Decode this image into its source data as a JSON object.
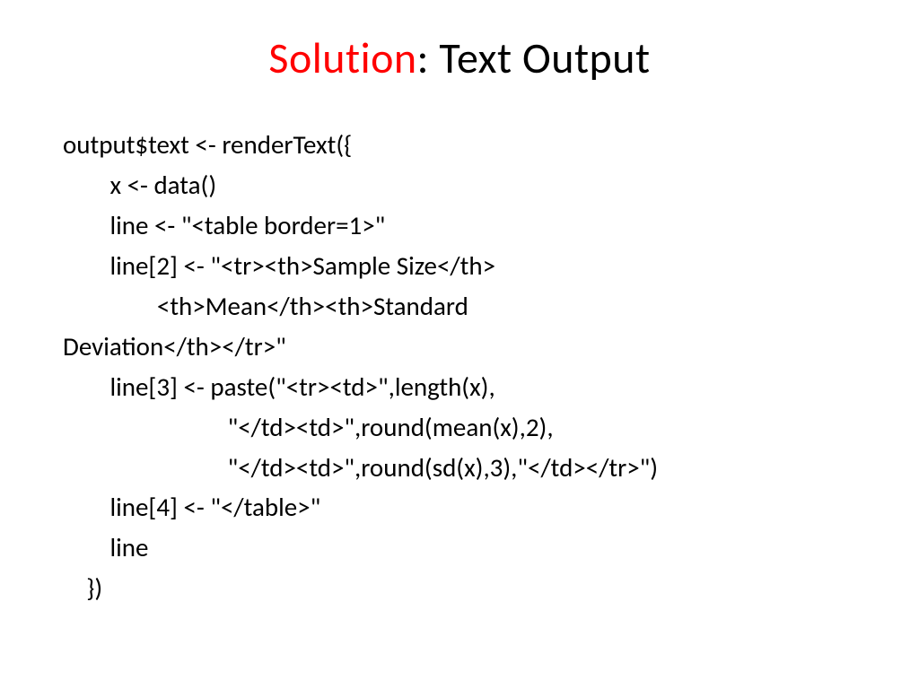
{
  "title": {
    "red": "Solution",
    "black": ": Text Output"
  },
  "code": {
    "line1": "output$text <- renderText({",
    "line2": "        x <- data()",
    "line3": "        line <- \"<table border=1>\"",
    "line4": "        line[2] <- \"<tr><th>Sample Size</th>",
    "line5": "                <th>Mean</th><th>Standard",
    "line6": "Deviation</th></tr>\"",
    "line7": "        line[3] <- paste(\"<tr><td>\",length(x),",
    "line8": "                            \"</td><td>\",round(mean(x),2),",
    "line9": "                            \"</td><td>\",round(sd(x),3),\"</td></tr>\")",
    "line10": "        line[4] <- \"</table>\"",
    "line11": "        line",
    "line12": "    })"
  }
}
